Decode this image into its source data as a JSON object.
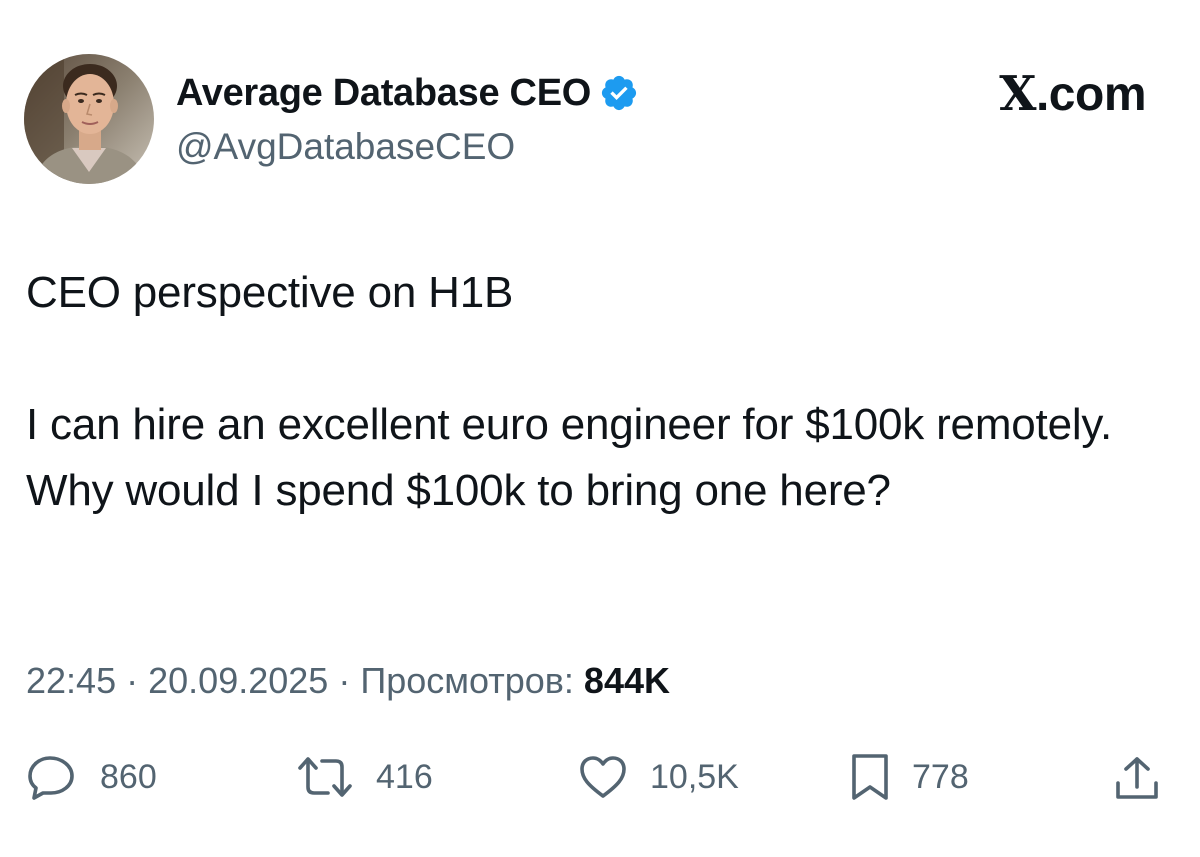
{
  "header": {
    "display_name": "Average Database CEO",
    "handle": "@AvgDatabaseCEO",
    "site_label_x": "X",
    "site_label_rest": ".com",
    "avatar_icon": "profile-photo",
    "verified_icon": "verified-badge-icon"
  },
  "tweet": {
    "line1": "CEO perspective on H1B",
    "paragraph2": "I can hire an excellent euro engineer for $100k remotely. Why would I spend $100k to bring one here?"
  },
  "meta": {
    "time": "22:45",
    "separator": "·",
    "date": "20.09.2025",
    "views_label": "Просмотров:",
    "views_count": "844K"
  },
  "actions": {
    "reply_count": "860",
    "retweet_count": "416",
    "like_count": "10,5K",
    "bookmark_count": "778"
  },
  "colors": {
    "text_primary": "#0f1419",
    "text_secondary": "#536471",
    "verified_blue": "#1d9bf0"
  }
}
